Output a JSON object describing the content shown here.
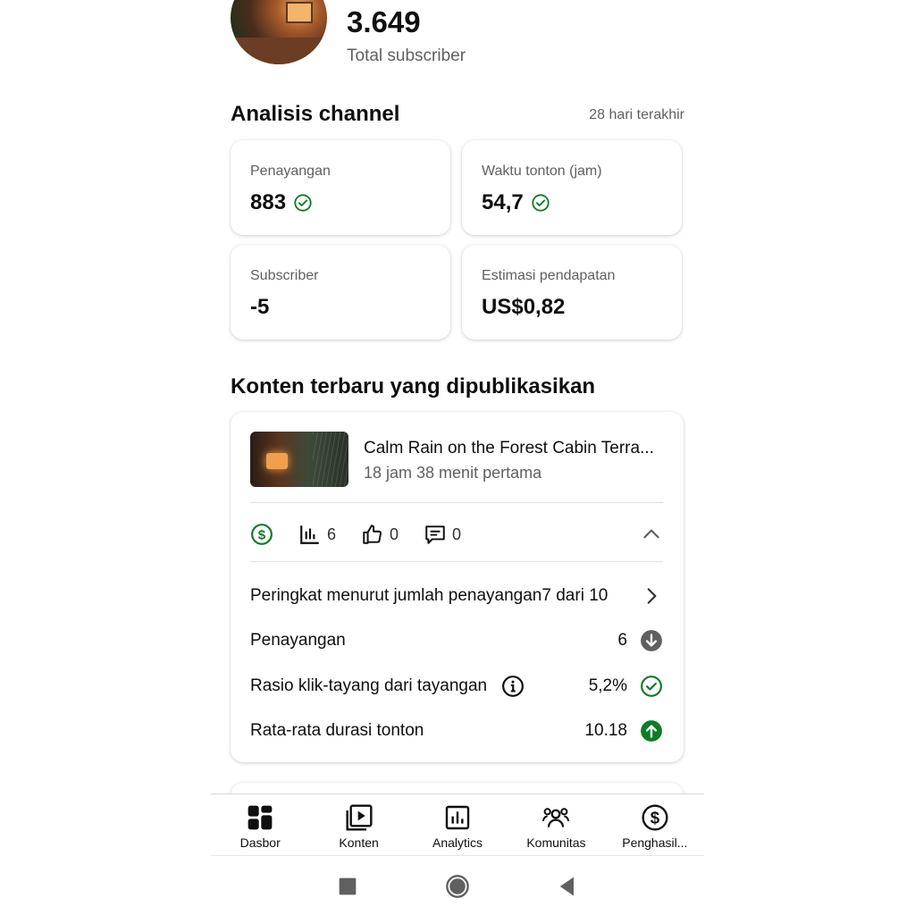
{
  "channel": {
    "subscriber_count": "3.649",
    "subscriber_label": "Total subscriber"
  },
  "analytics": {
    "title": "Analisis channel",
    "range": "28 hari terakhir",
    "cards": [
      {
        "label": "Penayangan",
        "value": "883",
        "check_icon": "check-circle-icon"
      },
      {
        "label": "Waktu tonton (jam)",
        "value": "54,7",
        "check_icon": "check-circle-icon"
      },
      {
        "label": "Subscriber",
        "value": "-5"
      },
      {
        "label": "Estimasi pendapatan",
        "value": "US$0,82"
      }
    ]
  },
  "latest": {
    "title": "Konten terbaru yang dipublikasikan",
    "video_title": "Calm Rain on the Forest Cabin Terra...",
    "video_subtitle": "18 jam 38 menit pertama",
    "metrics": {
      "views": "6",
      "likes": "0",
      "comments": "0"
    },
    "rows": [
      {
        "label": "Peringkat menurut jumlah penayangan",
        "value": "7 dari 10",
        "icon": "chevron-right-icon"
      },
      {
        "label": "Penayangan",
        "value": "6",
        "icon": "arrow-down-circle-icon"
      },
      {
        "label": "Rasio klik-tayang dari tayangan",
        "value": "5,2%",
        "icon": "check-circle-icon"
      },
      {
        "label": "Rata-rata durasi tonton",
        "value": "10.18",
        "icon": "arrow-up-circle-icon"
      }
    ]
  },
  "nav": [
    {
      "label": "Dasbor",
      "icon": "dashboard-icon"
    },
    {
      "label": "Konten",
      "icon": "content-icon"
    },
    {
      "label": "Analytics",
      "icon": "analytics-icon"
    },
    {
      "label": "Komunitas",
      "icon": "community-icon"
    },
    {
      "label": "Penghasil...",
      "icon": "earn-icon"
    }
  ],
  "colors": {
    "green": "#0f7b26",
    "text": "#0f0f0f",
    "secondary": "#606060"
  }
}
